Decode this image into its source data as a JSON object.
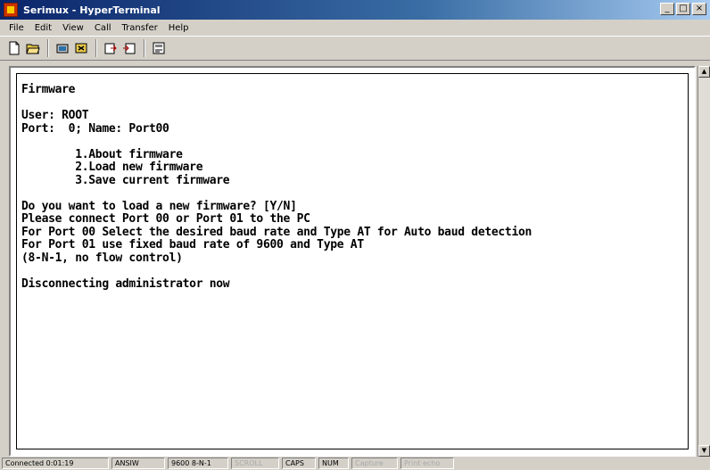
{
  "window": {
    "title": "Serimux - HyperTerminal",
    "buttons": [
      "_",
      "□",
      "×"
    ]
  },
  "menubar": {
    "items": [
      "File",
      "Edit",
      "View",
      "Call",
      "Transfer",
      "Help"
    ]
  },
  "toolbar": {
    "icons": [
      "new-icon",
      "open-icon",
      "connect-icon",
      "disconnect-icon",
      "send-icon",
      "receive-icon",
      "properties-icon"
    ]
  },
  "terminal": {
    "lines": [
      "Firmware",
      "",
      "User: ROOT",
      "Port:  0; Name: Port00",
      "",
      "        1.About firmware",
      "        2.Load new firmware",
      "        3.Save current firmware",
      "",
      "Do you want to load a new firmware? [Y/N]",
      "Please connect Port 00 or Port 01 to the PC",
      "For Port 00 Select the desired baud rate and Type AT for Auto baud detection",
      "For Port 01 use fixed baud rate of 9600 and Type AT",
      "(8-N-1, no flow control)",
      "",
      "Disconnecting administrator now"
    ]
  },
  "statusbar": {
    "connected": "Connected 0:01:19",
    "emulation": "ANSIW",
    "settings": "9600 8-N-1",
    "scroll": "SCROLL",
    "caps": "CAPS",
    "num": "NUM",
    "capture": "Capture",
    "echo": "Print echo"
  }
}
